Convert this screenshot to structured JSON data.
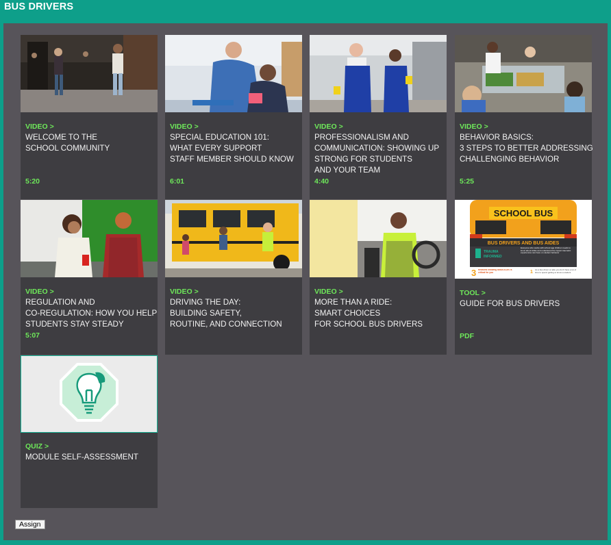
{
  "header": {
    "title": "BUS DRIVERS"
  },
  "cards": [
    {
      "type": "VIDEO >",
      "title_lines": [
        "WELCOME TO THE",
        "SCHOOL COMMUNITY"
      ],
      "meta": "5:20"
    },
    {
      "type": "VIDEO >",
      "title_lines": [
        "SPECIAL EDUCATION 101:",
        "WHAT EVERY SUPPORT",
        "STAFF MEMBER SHOULD KNOW"
      ],
      "meta": "6:01"
    },
    {
      "type": "VIDEO >",
      "title_lines": [
        "PROFESSIONALISM AND",
        "COMMUNICATION: SHOWING UP",
        "STRONG FOR STUDENTS",
        "AND YOUR TEAM"
      ],
      "meta": "4:40"
    },
    {
      "type": "VIDEO >",
      "title_lines": [
        "BEHAVIOR BASICS:",
        "3 STEPS TO BETTER ADDRESSING",
        "CHALLENGING BEHAVIOR"
      ],
      "meta": "5:25"
    },
    {
      "type": "VIDEO >",
      "title_lines": [
        "REGULATION AND",
        "CO-REGULATION: HOW YOU HELP",
        "STUDENTS STAY STEADY"
      ],
      "meta": "5:07"
    },
    {
      "type": "VIDEO >",
      "title_lines": [
        "DRIVING THE DAY:",
        "BUILDING SAFETY,",
        "ROUTINE, AND CONNECTION"
      ],
      "meta": ""
    },
    {
      "type": "VIDEO >",
      "title_lines": [
        "MORE THAN A RIDE:",
        "SMART CHOICES",
        "FOR SCHOOL BUS DRIVERS"
      ],
      "meta": ""
    },
    {
      "type": "TOOL >",
      "title_lines": [
        "GUIDE FOR BUS DRIVERS"
      ],
      "meta": "PDF"
    },
    {
      "type": "QUIZ >",
      "title_lines": [
        "MODULE SELF-ASSESSMENT"
      ],
      "meta": ""
    }
  ],
  "guide_thumbnail": {
    "bus_sign": "SCHOOL BUS",
    "banner": "BUS DRIVERS AND BUS AIDES",
    "logo_line1": "TRAUMA",
    "logo_line2": "INFORMED",
    "intro_text": "Everyone who works with school age children needs to know about ACEs and understand the impact traumatic experiences can have on student behavior",
    "reasons_number": "3",
    "reasons_text": "Reasons knowing about ACEs is critical for you",
    "point_number": "1",
    "point_text": "As a bus driver or aide you don't have a lot of time to spend getting to know a student."
  },
  "footer": {
    "assign_label": "Assign"
  },
  "colors": {
    "accent": "#0e9f8a",
    "panel": "#57545a",
    "card": "#3e3d41",
    "type_label": "#6ee85a"
  }
}
